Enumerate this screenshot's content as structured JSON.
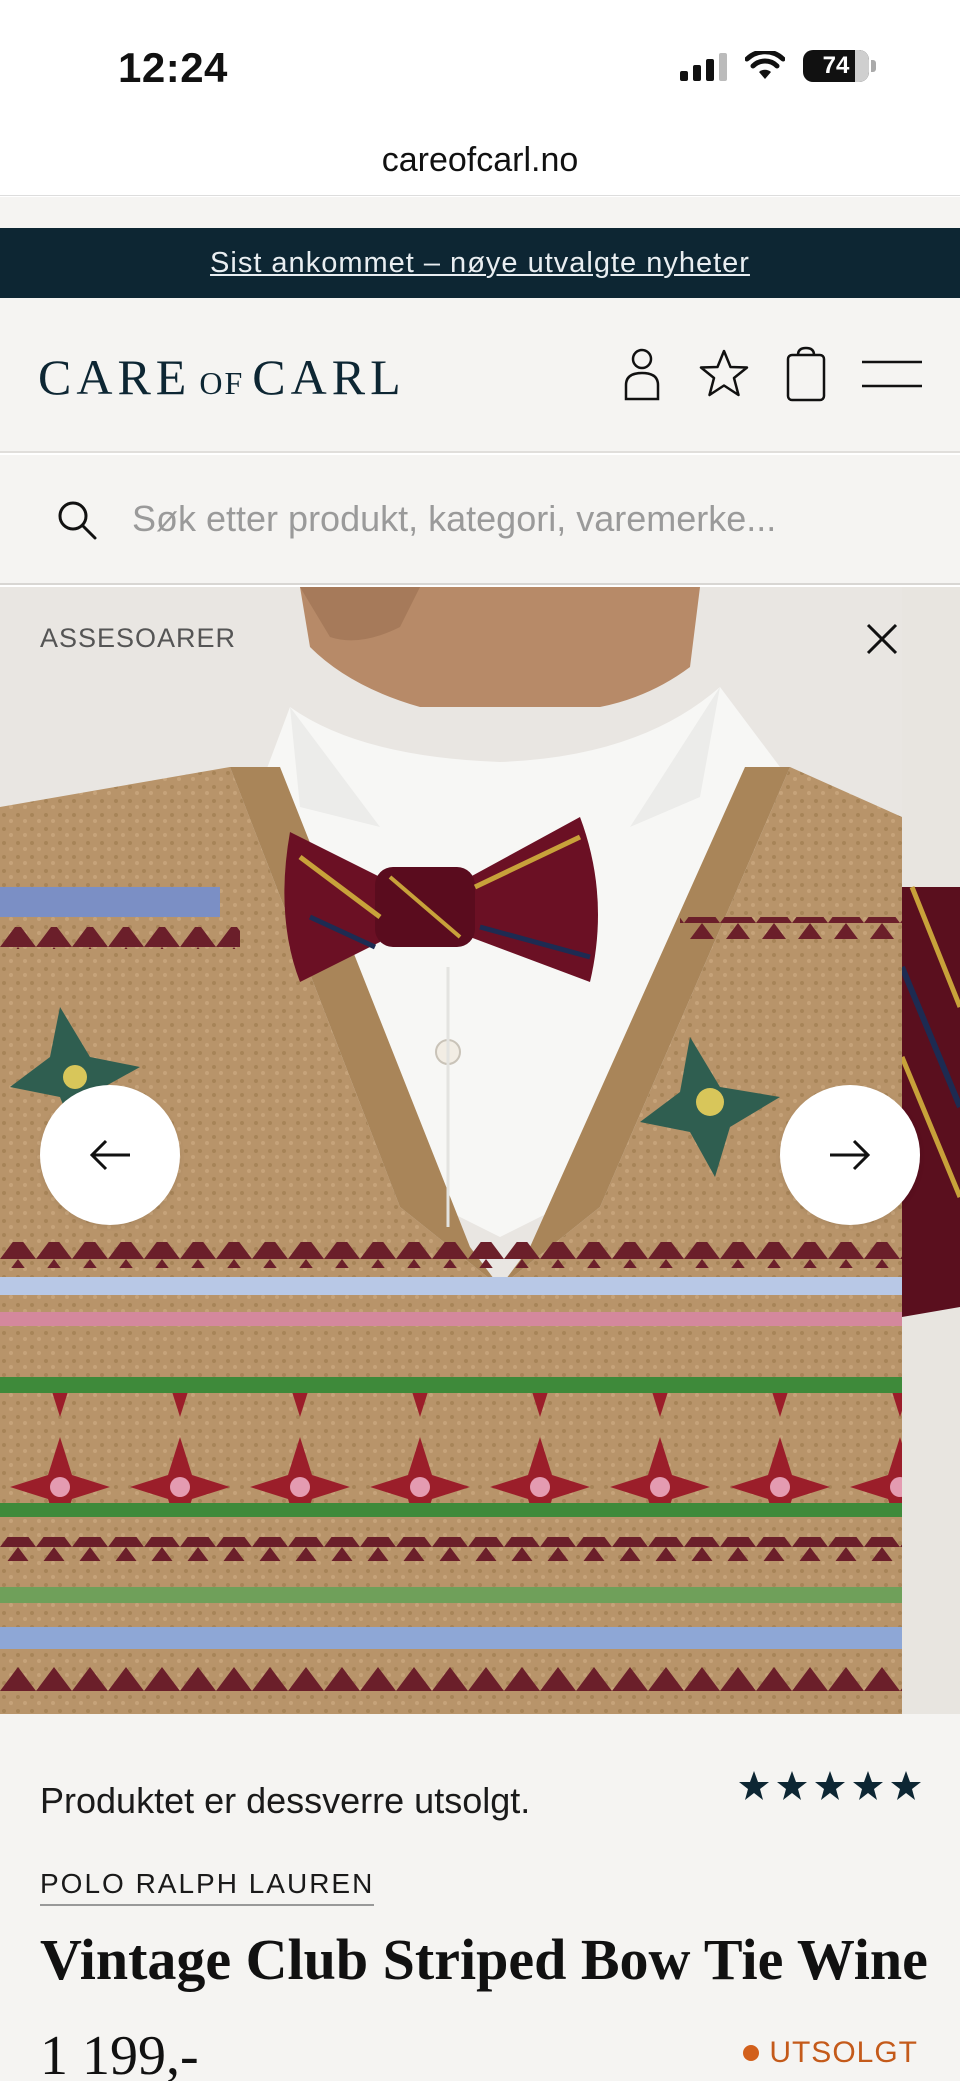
{
  "status_bar": {
    "time": "12:24",
    "battery": "74"
  },
  "browser": {
    "url": "careofcarl.no"
  },
  "banner": {
    "text": "Sist ankommet – nøye utvalgte nyheter"
  },
  "header": {
    "logo_main_left": "CARE",
    "logo_of": "OF",
    "logo_main_right": "CARL",
    "icons": [
      "account-icon",
      "wishlist-star-icon",
      "shopping-bag-icon",
      "menu-icon"
    ]
  },
  "search": {
    "placeholder": "Søk etter produkt, kategori, varemerke..."
  },
  "gallery": {
    "category": "ASSESOARER",
    "icons": [
      "close-icon",
      "arrow-left-icon",
      "arrow-right-icon"
    ]
  },
  "product": {
    "soldout_message": "Produktet er dessverre utsolgt.",
    "rating_stars": 5,
    "brand": "POLO RALPH LAUREN",
    "title": "Vintage Club Striped Bow Tie Wine",
    "price": "1 199,-",
    "stock_status": "UTSOLGT"
  },
  "colors": {
    "navy": "#0d2633",
    "background": "#f5f4f2",
    "soldout_orange": "#d2601c"
  }
}
